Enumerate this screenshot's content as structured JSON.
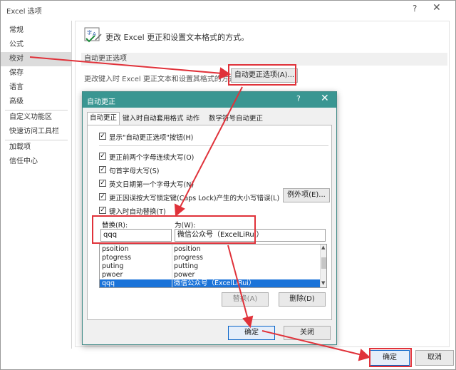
{
  "window": {
    "title": "Excel 选项",
    "help": "?",
    "close": "✕"
  },
  "sidebar": {
    "items": [
      "常规",
      "公式",
      "校对",
      "保存",
      "语言",
      "高级",
      "自定义功能区",
      "快速访问工具栏",
      "加载项",
      "信任中心"
    ],
    "active_index": 2
  },
  "main": {
    "header": "更改 Excel 更正和设置文本格式的方式。",
    "section_title": "自动更正选项",
    "autocorrect_desc": "更改键入时 Excel 更正文本和设置其格式的方式：",
    "autocorrect_button": "自动更正选项(A)..."
  },
  "footer": {
    "ok": "确定",
    "cancel": "取消"
  },
  "dialog": {
    "title": "自动更正",
    "help": "?",
    "close": "✕",
    "tabs": [
      "自动更正",
      "键入时自动套用格式",
      "动作",
      "数学符号自动更正"
    ],
    "active_tab": 0,
    "show_buttons": "显示\"自动更正选项\"按钮(H)",
    "options": [
      "更正前两个字母连续大写(O)",
      "句首字母大写(S)",
      "英文日期第一个字母大写(N)",
      "更正因误按大写锁定键(Caps Lock)产生的大小写错误(L)",
      "键入时自动替换(T)"
    ],
    "exceptions_button": "例外项(E)...",
    "replace_label": "替换(R):",
    "with_label": "为(W):",
    "replace_value": "qqq",
    "with_value": "微信公众号（ExcelLiRui）",
    "list": [
      {
        "from": "psoition",
        "to": "position"
      },
      {
        "from": "ptogress",
        "to": "progress"
      },
      {
        "from": "puting",
        "to": "putting"
      },
      {
        "from": "pwoer",
        "to": "power"
      },
      {
        "from": "qqq",
        "to": "微信公众号（ExcelLiRui）"
      }
    ],
    "selected_row": 4,
    "replace_button": "替换(A)",
    "delete_button": "删除(D)",
    "ok": "确定",
    "close_button": "关闭"
  },
  "icons": {
    "checkmark": "✓",
    "scroll_up": "▲",
    "scroll_down": "▼"
  },
  "colors": {
    "dialog_title_bg": "#3a9692",
    "annotation_red": "#e0323a",
    "selection_blue": "#1a73d9"
  }
}
